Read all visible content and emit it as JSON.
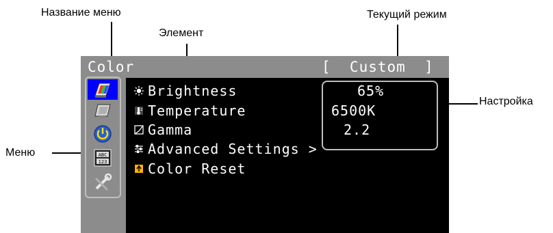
{
  "annotations": {
    "menu_name": "Название меню",
    "element": "Элемент",
    "current_mode": "Текущий режим",
    "setting": "Настройка",
    "menu": "Меню"
  },
  "osd": {
    "title": "Color",
    "mode": "[  Custom  ]",
    "icons": [
      {
        "name": "color-menu-icon",
        "active": true
      },
      {
        "name": "screen-menu-icon",
        "active": false
      },
      {
        "name": "power-menu-icon",
        "active": false
      },
      {
        "name": "language-menu-icon",
        "active": false
      },
      {
        "name": "tools-menu-icon",
        "active": false
      }
    ],
    "items": [
      {
        "label": "Brightness",
        "icon": "brightness-icon"
      },
      {
        "label": "Temperature",
        "icon": "temperature-icon"
      },
      {
        "label": "Gamma",
        "icon": "gamma-icon"
      },
      {
        "label": "Advanced Settings >",
        "icon": "advanced-settings-icon"
      },
      {
        "label": "Color Reset",
        "icon": "color-reset-icon"
      }
    ],
    "values": {
      "brightness": "65%",
      "temperature": "6500K",
      "gamma": "2.2"
    }
  },
  "colors": {
    "osd_background": "#000000",
    "osd_chrome": "#8c8c8c",
    "active_highlight": "#0000ff",
    "frame_outline": "#bfbfbf",
    "text": "#ffffff"
  }
}
